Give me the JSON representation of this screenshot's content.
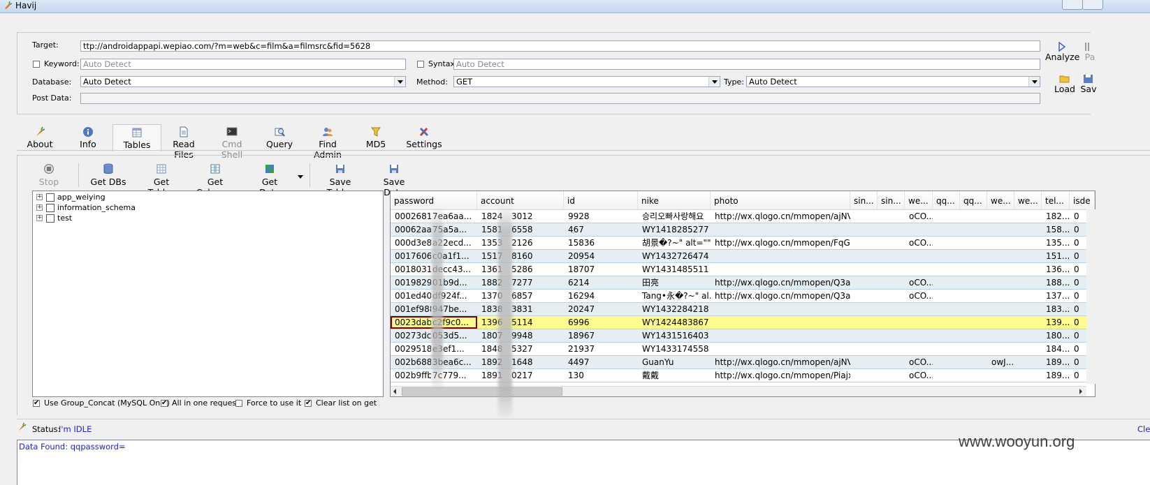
{
  "window": {
    "title": "Havij"
  },
  "target": {
    "target_label": "Target:",
    "target_value": "ttp://androidappapi.wepiao.com/?m=web&c=film&a=filmsrc&fid=5628",
    "keyword_label": "Keyword:",
    "keyword_placeholder": "Auto Detect",
    "syntax_label": "Syntax:",
    "syntax_placeholder": "Auto Detect",
    "database_label": "Database:",
    "database_value": "Auto Detect",
    "method_label": "Method:",
    "method_value": "GET",
    "type_label": "Type:",
    "type_value": "Auto Detect",
    "postdata_label": "Post Data:"
  },
  "side_buttons": {
    "analyze": "Analyze",
    "pause": "Pa",
    "load": "Load",
    "save": "Sav"
  },
  "tabs": [
    {
      "label": "About",
      "icon": "carrot-icon"
    },
    {
      "label": "Info",
      "icon": "info-icon"
    },
    {
      "label": "Tables",
      "icon": "table-icon"
    },
    {
      "label": "Read Files",
      "icon": "file-icon"
    },
    {
      "label": "Cmd Shell",
      "icon": "terminal-icon"
    },
    {
      "label": "Query",
      "icon": "query-icon"
    },
    {
      "label": "Find Admin",
      "icon": "admin-icon"
    },
    {
      "label": "MD5",
      "icon": "key-icon"
    },
    {
      "label": "Settings",
      "icon": "tools-icon"
    }
  ],
  "toolbar": {
    "stop": "Stop",
    "get_dbs": "Get DBs",
    "get_tables": "Get Tables",
    "get_columns": "Get Columns",
    "get_data": "Get Data",
    "save_tables": "Save Tables",
    "save_data": "Save Data"
  },
  "tree": [
    "app_weiying",
    "information_schema",
    "test"
  ],
  "grid": {
    "columns": [
      "password",
      "account",
      "id",
      "nike",
      "photo",
      "sin...",
      "sin...",
      "we...",
      "qq...",
      "qq...",
      "we...",
      "we...",
      "tel...",
      "isde"
    ],
    "rows": [
      [
        "00026810",
        "7ea6aa...",
        "1824",
        "3012",
        "9928",
        "승리오빠사랑해요",
        "http://wx.qlogo.cn/mmopen/ajNV...",
        "oCO...",
        "",
        "182...",
        "0"
      ],
      [
        "00062aa3",
        "75a5a...",
        "1581",
        "6558",
        "467",
        "WY1418285277",
        "",
        "",
        "",
        "158...",
        "0"
      ],
      [
        "000d3e82",
        "a22ecd...",
        "1353",
        "2126",
        "15836",
        "胡景�?~\" alt=\"\"...",
        "http://wx.qlogo.cn/mmopen/FqGc...",
        "oCO...",
        "",
        "135...",
        "0"
      ],
      [
        "0017606a",
        "c0a1f1...",
        "1517",
        "8160",
        "20954",
        "WY1432726474",
        "",
        "",
        "",
        "151...",
        "0"
      ],
      [
        "0018031",
        "decc43...",
        "1361",
        "5286",
        "18707",
        "WY1431485511",
        "",
        "",
        "",
        "136...",
        "0"
      ],
      [
        "00198292",
        "01b9d...",
        "1882",
        "7277",
        "6214",
        "田亮",
        "http://wx.qlogo.cn/mmopen/Q3au...",
        "oCO...",
        "",
        "188...",
        "0"
      ],
      [
        "001ed401",
        "df924f...",
        "1370",
        "6857",
        "16294",
        "Tang•永�?~\" al...",
        "http://wx.qlogo.cn/mmopen/Q3au...",
        "oCO...",
        "",
        "137...",
        "0"
      ],
      [
        "001ef988",
        "947be...",
        "1838",
        "3831",
        "20247",
        "WY1432284218",
        "",
        "",
        "",
        "183...",
        "0"
      ],
      [
        "0023dab3",
        "c2f9c0...",
        "1396",
        "5114",
        "6996",
        "WY1424483867",
        "",
        "",
        "",
        "139...",
        "0"
      ],
      [
        "00273dc0",
        "053d5...",
        "1807",
        "9948",
        "18967",
        "WY1431516403",
        "",
        "",
        "",
        "180...",
        "0"
      ],
      [
        "0029518",
        "e3ef1...",
        "1848",
        "5327",
        "21937",
        "WY1433174558",
        "",
        "",
        "",
        "184...",
        "0"
      ],
      [
        "002b688c",
        "3bea6c...",
        "1892",
        "1648",
        "4497",
        "GuanYu",
        "http://wx.qlogo.cn/mmopen/ajNV...",
        "oCO...",
        "owJ...",
        "189...",
        "0"
      ],
      [
        "002b9ffb",
        "7c779...",
        "1891",
        "0217",
        "130",
        "戴戴",
        "http://wx.qlogo.cn/mmopen/Piajx...",
        "oCO...",
        "",
        "189...",
        "0"
      ]
    ]
  },
  "options": {
    "group_concat": "Use Group_Concat (MySQL Only)",
    "all_in_one": "All in one request.",
    "force": "Force to use it",
    "clear_list": "Clear list on get"
  },
  "status": {
    "label": "Status:",
    "value": "I'm IDLE",
    "clear": "Cle"
  },
  "log": {
    "line": "Data Found: qqpassword="
  },
  "watermark": "www.wooyun.org"
}
